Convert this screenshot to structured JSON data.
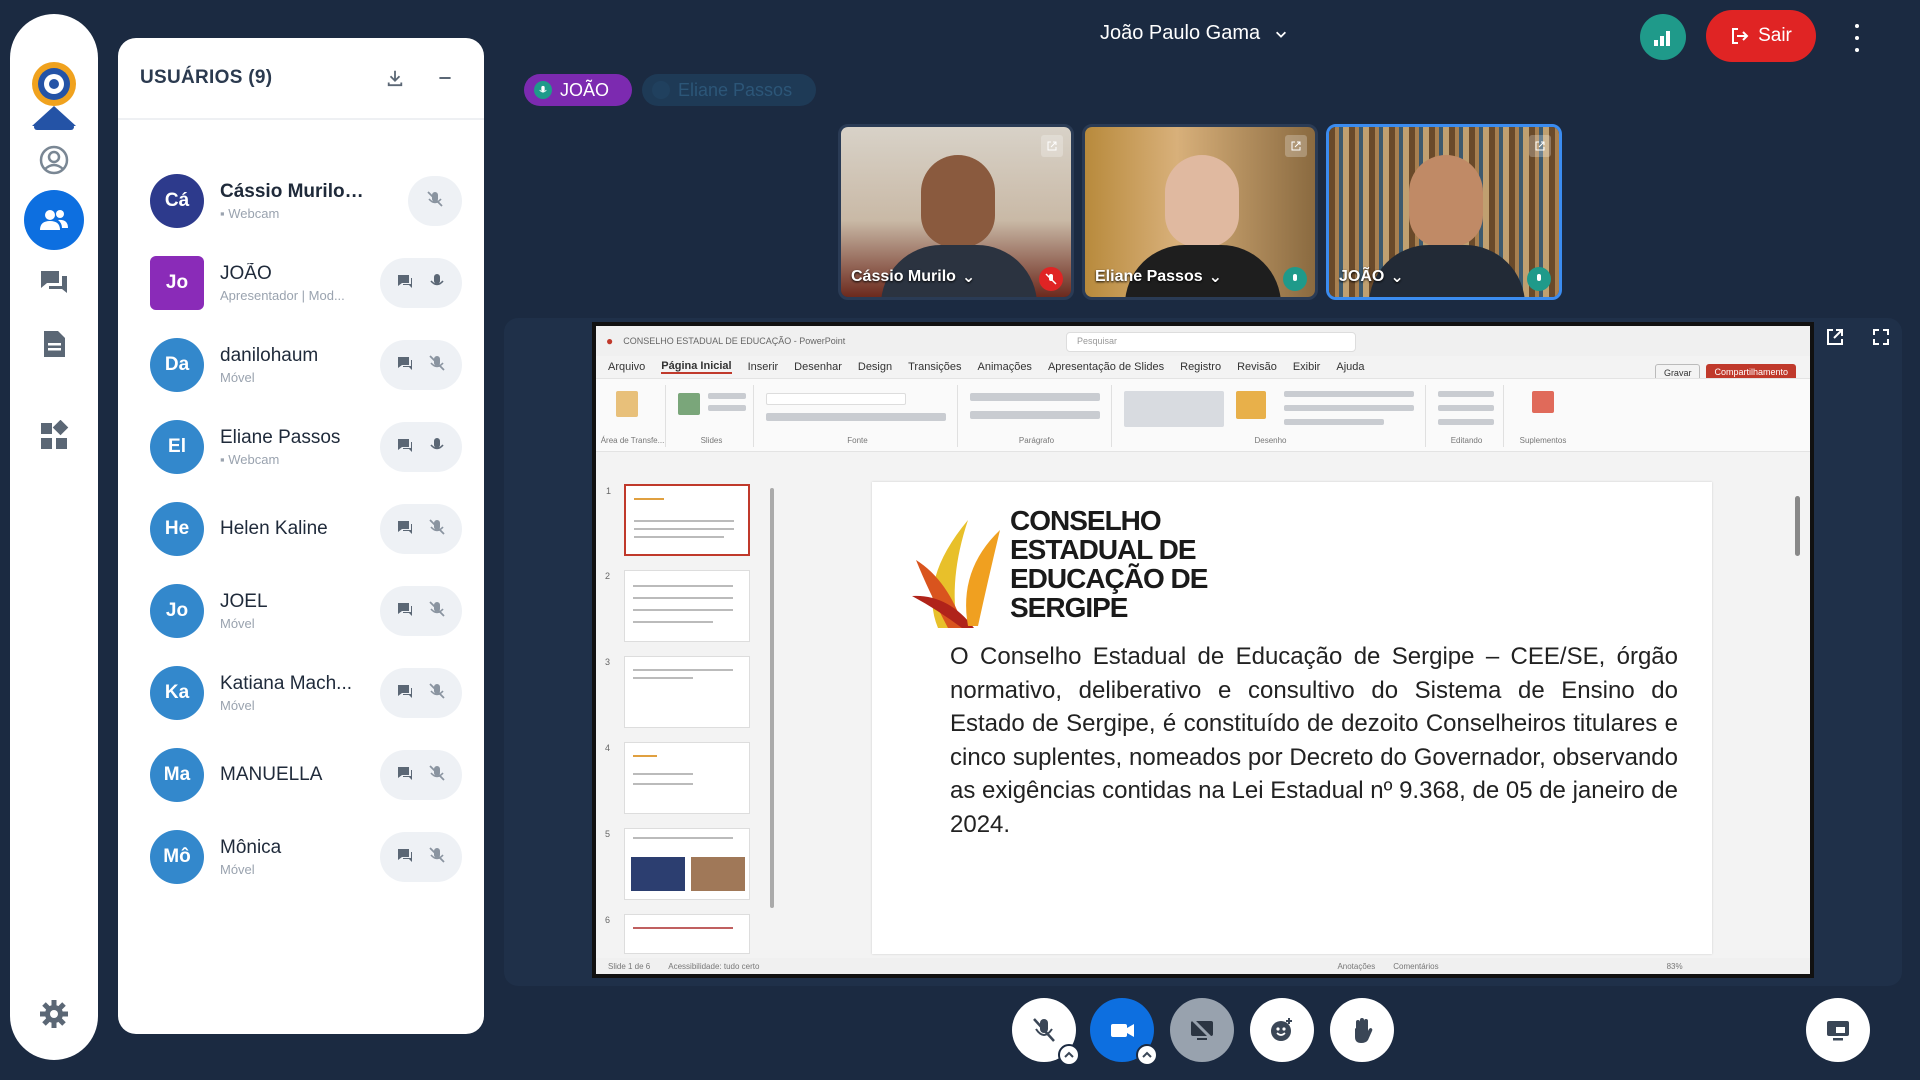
{
  "top_bar": {
    "host_name": "João Paulo Gama",
    "leave_label": "Sair"
  },
  "users_panel": {
    "title": "USUÁRIOS (9)",
    "users": [
      {
        "initials": "Cá",
        "name": "Cássio Murilo (V...",
        "sub": "Webcam",
        "avatar_color": "#2d3a8c"
      },
      {
        "initials": "Jo",
        "name": "JOÃO",
        "sub": "Apresentador | Mod...",
        "avatar_color": "#8a2bb8"
      },
      {
        "initials": "Da",
        "name": "danilohaum",
        "sub": "Móvel",
        "avatar_color": "#3388cc"
      },
      {
        "initials": "El",
        "name": "Eliane Passos",
        "sub": "Webcam",
        "avatar_color": "#3388cc"
      },
      {
        "initials": "He",
        "name": "Helen Kaline",
        "sub": "",
        "avatar_color": "#3388cc"
      },
      {
        "initials": "Jo",
        "name": "JOEL",
        "sub": "Móvel",
        "avatar_color": "#3388cc"
      },
      {
        "initials": "Ka",
        "name": "Katiana Mach...",
        "sub": "Móvel",
        "avatar_color": "#3388cc"
      },
      {
        "initials": "Ma",
        "name": "MANUELLA",
        "sub": "",
        "avatar_color": "#3388cc"
      },
      {
        "initials": "Mô",
        "name": "Mônica",
        "sub": "Móvel",
        "avatar_color": "#3388cc"
      }
    ]
  },
  "speakers": {
    "active": "JOÃO",
    "idle": "Eliane Passos"
  },
  "webcams": [
    {
      "name": "Cássio Murilo",
      "mic": "muted"
    },
    {
      "name": "Eliane Passos",
      "mic": "on"
    },
    {
      "name": "JOÃO",
      "mic": "on"
    }
  ],
  "presentation": {
    "window_title": "CONSELHO ESTADUAL DE EDUCAÇÃO - PowerPoint",
    "search_placeholder": "Pesquisar",
    "menu": [
      "Arquivo",
      "Página Inicial",
      "Inserir",
      "Desenhar",
      "Design",
      "Transições",
      "Animações",
      "Apresentação de Slides",
      "Registro",
      "Revisão",
      "Exibir",
      "Ajuda"
    ],
    "record_label": "Gravar",
    "share_label": "Compartilhamento",
    "ribbon_groups": [
      "Área de Transfe...",
      "Slides",
      "Fonte",
      "Parágrafo",
      "Desenho",
      "Editando",
      "Suplementos"
    ],
    "slide_numbers": [
      "1",
      "2",
      "3",
      "4",
      "5",
      "6"
    ],
    "slide_brand": "CONSELHO\nESTADUAL DE\nEDUCAÇÃO DE\nSERGIPE",
    "slide_body": "O Conselho Estadual de Educação de Sergipe – CEE/SE, órgão normativo, deliberativo e consultivo do Sistema de Ensino do Estado de Sergipe, é constituído de dezoito Conselheiros titulares e cinco suplentes, nomeados por Decreto do Governador, observando as exigências contidas na Lei Estadual nº 9.368, de 05 de janeiro de 2024.",
    "status_left": "Slide 1 de 6",
    "status_access": "Acessibilidade: tudo certo",
    "status_notes": "Anotações",
    "status_comments": "Comentários",
    "zoom": "83%"
  },
  "colors": {
    "background": "#1b2a41",
    "accent_blue": "#0d6fe0",
    "leave_red": "#e02424",
    "presenter_purple": "#7c2ab0",
    "teal": "#1f9a8a"
  }
}
